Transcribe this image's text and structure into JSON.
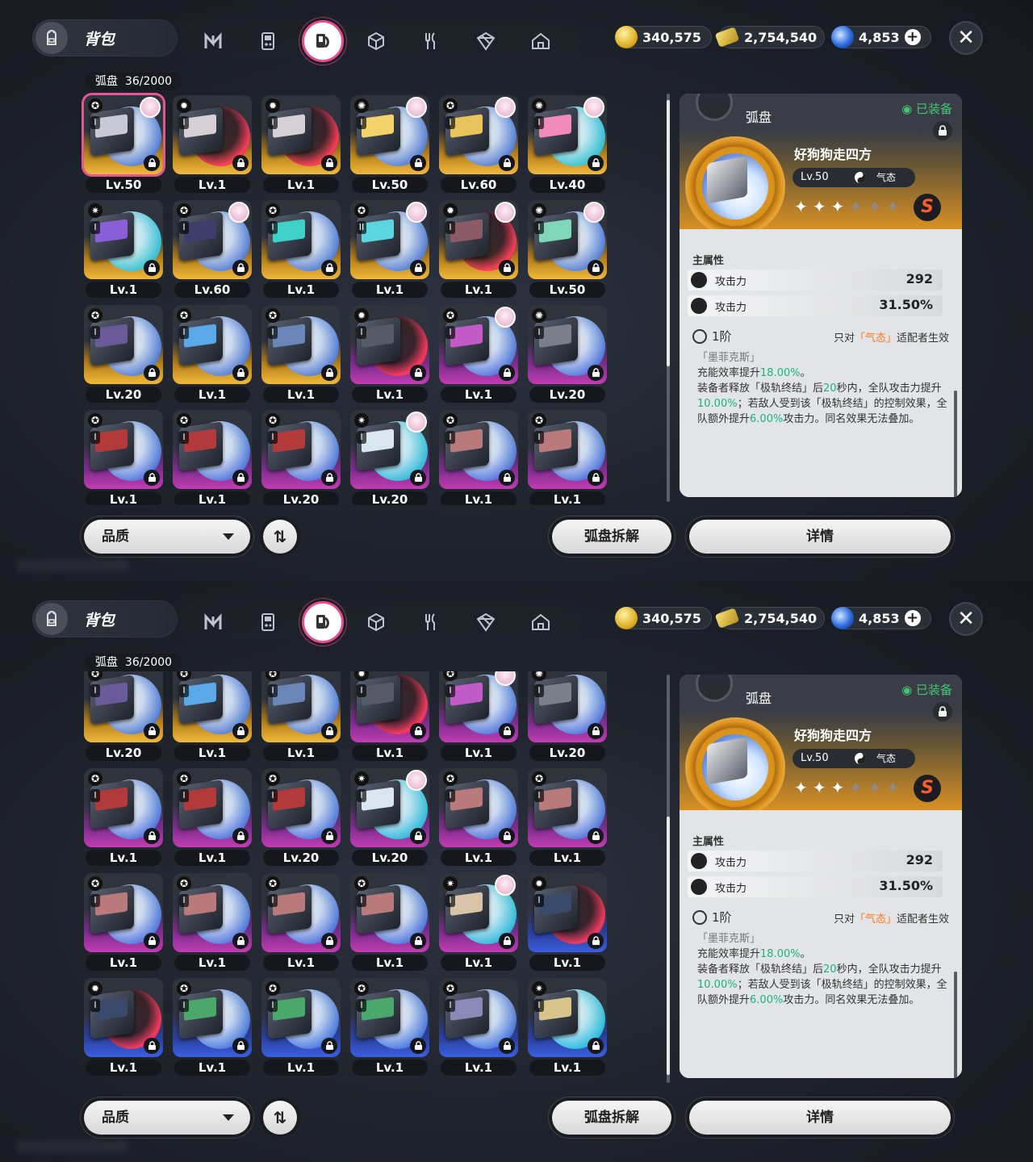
{
  "header": {
    "title": "背包",
    "tabs": [
      {
        "name": "agent-tab",
        "icon": "n-logo-icon"
      },
      {
        "name": "engine-tab",
        "icon": "gameboy-icon"
      },
      {
        "name": "drive-disc-tab",
        "icon": "disc-book-icon",
        "active": true
      },
      {
        "name": "materials-tab",
        "icon": "cube-icon"
      },
      {
        "name": "food-tab",
        "icon": "fork-knife-icon"
      },
      {
        "name": "gift-tab",
        "icon": "package-icon"
      },
      {
        "name": "home-tab",
        "icon": "house-icon"
      }
    ],
    "currencies": [
      {
        "icon": "gold-coin-icon",
        "value": "340,575"
      },
      {
        "icon": "ticket-icon",
        "value": "2,754,540"
      },
      {
        "icon": "polychrome-icon",
        "value": "4,853"
      }
    ],
    "add_symbol": "+",
    "close_symbol": "✕"
  },
  "inventory": {
    "label": "弧盘",
    "count": "36/2000"
  },
  "screen1": {
    "cards": [
      {
        "lv": "Lv.50",
        "rarity": "gold",
        "attr": "✪",
        "rank": "I",
        "disc": "blue",
        "avatar": true,
        "selected": true,
        "art": "#c9c9d4"
      },
      {
        "lv": "Lv.1",
        "rarity": "gold",
        "attr": "✹",
        "rank": "I",
        "disc": "red",
        "avatar": false,
        "art": "#d6d0d6"
      },
      {
        "lv": "Lv.1",
        "rarity": "gold",
        "attr": "✹",
        "rank": "I",
        "disc": "red",
        "avatar": false,
        "art": "#d6d0d6"
      },
      {
        "lv": "Lv.50",
        "rarity": "gold",
        "attr": "✺",
        "rank": "I",
        "disc": "blue",
        "avatar": true,
        "art": "#f3d36a"
      },
      {
        "lv": "Lv.60",
        "rarity": "gold",
        "attr": "✪",
        "rank": "I",
        "disc": "blue",
        "avatar": true,
        "art": "#e8c35c"
      },
      {
        "lv": "Lv.40",
        "rarity": "gold",
        "attr": "✺",
        "rank": "I",
        "disc": "cyan",
        "avatar": true,
        "art": "#f08bb8"
      },
      {
        "lv": "Lv.1",
        "rarity": "gold",
        "attr": "✷",
        "rank": "I",
        "disc": "cyan",
        "avatar": false,
        "art": "#8a5ed6"
      },
      {
        "lv": "Lv.60",
        "rarity": "gold",
        "attr": "✪",
        "rank": "I",
        "disc": "blue",
        "avatar": true,
        "art": "#3d3f6a"
      },
      {
        "lv": "Lv.1",
        "rarity": "gold",
        "attr": "✪",
        "rank": "I",
        "disc": "blue",
        "avatar": false,
        "art": "#3fd0c7"
      },
      {
        "lv": "Lv.1",
        "rarity": "gold",
        "attr": "✪",
        "rank": "II",
        "disc": "blue",
        "avatar": true,
        "art": "#5bd6e0"
      },
      {
        "lv": "Lv.1",
        "rarity": "gold",
        "attr": "✹",
        "rank": "I",
        "disc": "red",
        "avatar": true,
        "art": "#8a5a66"
      },
      {
        "lv": "Lv.50",
        "rarity": "gold",
        "attr": "✺",
        "rank": "I",
        "disc": "blue",
        "avatar": true,
        "art": "#7fd6b8"
      },
      {
        "lv": "Lv.20",
        "rarity": "gold",
        "attr": "✪",
        "rank": "I",
        "disc": "blue",
        "avatar": false,
        "art": "#6a5a9a"
      },
      {
        "lv": "Lv.1",
        "rarity": "gold",
        "attr": "✪",
        "rank": "I",
        "disc": "blue",
        "avatar": false,
        "art": "#5aa8e8"
      },
      {
        "lv": "Lv.1",
        "rarity": "gold",
        "attr": "✪",
        "rank": "I",
        "disc": "blue",
        "avatar": false,
        "art": "#6a86b8"
      },
      {
        "lv": "Lv.1",
        "rarity": "purple",
        "attr": "✹",
        "rank": "I",
        "disc": "red",
        "avatar": false,
        "art": "#555a66"
      },
      {
        "lv": "Lv.1",
        "rarity": "purple",
        "attr": "✪",
        "rank": "I",
        "disc": "blue",
        "avatar": true,
        "art": "#c25ac8"
      },
      {
        "lv": "Lv.20",
        "rarity": "purple",
        "attr": "✺",
        "rank": "I",
        "disc": "blue",
        "avatar": false,
        "art": "#7a7f8a"
      },
      {
        "lv": "Lv.1",
        "rarity": "purple",
        "attr": "✪",
        "rank": "I",
        "disc": "blue",
        "avatar": false,
        "art": "#b23a3a"
      },
      {
        "lv": "Lv.1",
        "rarity": "purple",
        "attr": "✪",
        "rank": "I",
        "disc": "blue",
        "avatar": false,
        "art": "#b23a3a"
      },
      {
        "lv": "Lv.20",
        "rarity": "purple",
        "attr": "✪",
        "rank": "I",
        "disc": "blue",
        "avatar": false,
        "art": "#b23a3a"
      },
      {
        "lv": "Lv.20",
        "rarity": "purple",
        "attr": "✷",
        "rank": "I",
        "disc": "cyan",
        "avatar": true,
        "art": "#d8e6f0"
      },
      {
        "lv": "Lv.1",
        "rarity": "purple",
        "attr": "✪",
        "rank": "I",
        "disc": "blue",
        "avatar": false,
        "art": "#b87a7a"
      },
      {
        "lv": "Lv.1",
        "rarity": "purple",
        "attr": "✪",
        "rank": "I",
        "disc": "blue",
        "avatar": false,
        "art": "#b87a7a"
      }
    ]
  },
  "screen2": {
    "cards": [
      {
        "lv": "Lv.20",
        "rarity": "gold",
        "attr": "✪",
        "rank": "I",
        "disc": "blue",
        "avatar": false,
        "art": "#6a5a9a"
      },
      {
        "lv": "Lv.1",
        "rarity": "gold",
        "attr": "✪",
        "rank": "I",
        "disc": "blue",
        "avatar": false,
        "art": "#5aa8e8"
      },
      {
        "lv": "Lv.1",
        "rarity": "gold",
        "attr": "✪",
        "rank": "I",
        "disc": "blue",
        "avatar": false,
        "art": "#6a86b8"
      },
      {
        "lv": "Lv.1",
        "rarity": "purple",
        "attr": "✹",
        "rank": "I",
        "disc": "red",
        "avatar": false,
        "art": "#555a66"
      },
      {
        "lv": "Lv.1",
        "rarity": "purple",
        "attr": "✪",
        "rank": "I",
        "disc": "blue",
        "avatar": true,
        "art": "#c25ac8"
      },
      {
        "lv": "Lv.20",
        "rarity": "purple",
        "attr": "✺",
        "rank": "I",
        "disc": "blue",
        "avatar": false,
        "art": "#7a7f8a"
      },
      {
        "lv": "Lv.1",
        "rarity": "purple",
        "attr": "✪",
        "rank": "I",
        "disc": "blue",
        "avatar": false,
        "art": "#b23a3a"
      },
      {
        "lv": "Lv.1",
        "rarity": "purple",
        "attr": "✪",
        "rank": "I",
        "disc": "blue",
        "avatar": false,
        "art": "#b23a3a"
      },
      {
        "lv": "Lv.20",
        "rarity": "purple",
        "attr": "✪",
        "rank": "I",
        "disc": "blue",
        "avatar": false,
        "art": "#b23a3a"
      },
      {
        "lv": "Lv.20",
        "rarity": "purple",
        "attr": "✷",
        "rank": "I",
        "disc": "cyan",
        "avatar": true,
        "art": "#d8e6f0"
      },
      {
        "lv": "Lv.1",
        "rarity": "purple",
        "attr": "✪",
        "rank": "I",
        "disc": "blue",
        "avatar": false,
        "art": "#b87a7a"
      },
      {
        "lv": "Lv.1",
        "rarity": "purple",
        "attr": "✪",
        "rank": "I",
        "disc": "blue",
        "avatar": false,
        "art": "#b87a7a"
      },
      {
        "lv": "Lv.1",
        "rarity": "purple",
        "attr": "✪",
        "rank": "I",
        "disc": "blue",
        "avatar": false,
        "art": "#b87a7a"
      },
      {
        "lv": "Lv.1",
        "rarity": "purple",
        "attr": "✪",
        "rank": "I",
        "disc": "blue",
        "avatar": false,
        "art": "#b87a7a"
      },
      {
        "lv": "Lv.1",
        "rarity": "purple",
        "attr": "✪",
        "rank": "I",
        "disc": "blue",
        "avatar": false,
        "art": "#b87a7a"
      },
      {
        "lv": "Lv.1",
        "rarity": "purple",
        "attr": "✪",
        "rank": "I",
        "disc": "blue",
        "avatar": false,
        "art": "#b87a7a"
      },
      {
        "lv": "Lv.1",
        "rarity": "purple",
        "attr": "✷",
        "rank": "I",
        "disc": "cyan",
        "avatar": true,
        "art": "#d8c4a8"
      },
      {
        "lv": "Lv.1",
        "rarity": "blue",
        "attr": "✹",
        "rank": "I",
        "disc": "red",
        "avatar": false,
        "art": "#3a4a6a"
      },
      {
        "lv": "Lv.1",
        "rarity": "blue",
        "attr": "✹",
        "rank": "I",
        "disc": "red",
        "avatar": false,
        "art": "#3a4a6a"
      },
      {
        "lv": "Lv.1",
        "rarity": "blue",
        "attr": "✪",
        "rank": "I",
        "disc": "blue",
        "avatar": false,
        "art": "#4aa86a"
      },
      {
        "lv": "Lv.1",
        "rarity": "blue",
        "attr": "✪",
        "rank": "I",
        "disc": "blue",
        "avatar": false,
        "art": "#4aa86a"
      },
      {
        "lv": "Lv.1",
        "rarity": "blue",
        "attr": "✪",
        "rank": "I",
        "disc": "blue",
        "avatar": false,
        "art": "#4aa86a"
      },
      {
        "lv": "Lv.1",
        "rarity": "blue",
        "attr": "✪",
        "rank": "I",
        "disc": "blue",
        "avatar": false,
        "art": "#8a8ab8"
      },
      {
        "lv": "Lv.1",
        "rarity": "blue",
        "attr": "✷",
        "rank": "I",
        "disc": "cyan",
        "avatar": false,
        "art": "#d8c48a"
      }
    ]
  },
  "detail": {
    "header_title": "弧盘",
    "equipped": "◉ 已装备",
    "disc_name": "好狗狗走四方",
    "level": "Lv.50",
    "element": "气态",
    "stars_filled": 3,
    "stars_total": 6,
    "rank_letter": "S",
    "main_stat_title": "主属性",
    "stats": [
      {
        "name": "攻击力",
        "value": "292"
      },
      {
        "name": "攻击力",
        "value": "31.50%"
      }
    ],
    "tier": "1阶",
    "note_prefix": "只对",
    "note_highlight": "「气态」",
    "note_suffix": "适配者生效",
    "effect_name": "「墨菲克斯」",
    "effect_line1_a": "充能效率提升",
    "effect_line1_b": "18.00%",
    "effect_line1_c": "。",
    "effect_line2_a": "装备者释放「极轨终结」后",
    "effect_line2_b": "20",
    "effect_line2_c": "秒内，全队攻击力提升",
    "effect_line2_d": "10.00%",
    "effect_line2_e": "；若敌人受到该「极轨终结」的控制效果，全队额外提升",
    "effect_line2_f": "6.00%",
    "effect_line2_g": "攻击力。同名效果无法叠加。"
  },
  "footer": {
    "sort_label": "品质",
    "sort_toggle_symbol": "⇅",
    "dismantle_label": "弧盘拆解",
    "details_label": "详情"
  },
  "colors": {
    "accent_pink": "#e84a8a",
    "equipped_green": "#41c774",
    "highlight_orange": "#ff7a1a",
    "value_green": "#19b47c"
  }
}
